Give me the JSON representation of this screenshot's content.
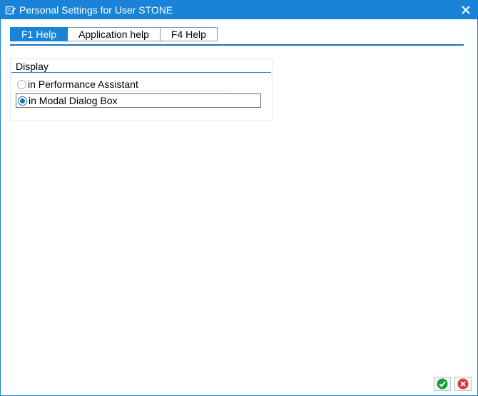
{
  "window": {
    "title": "Personal Settings for User STONE"
  },
  "tabs": [
    {
      "label": "F1 Help",
      "active": true
    },
    {
      "label": "Application help",
      "active": false
    },
    {
      "label": "F4 Help",
      "active": false
    }
  ],
  "display_group": {
    "title": "Display",
    "options": [
      {
        "label": "in Performance Assistant",
        "selected": false
      },
      {
        "label": "in Modal Dialog Box",
        "selected": true
      }
    ]
  },
  "icons": {
    "title": "settings-edit-icon",
    "close": "close-icon",
    "ok": "checkmark-icon",
    "cancel": "cancel-icon"
  },
  "colors": {
    "accent": "#1883d7",
    "ok_green": "#1e9b3c",
    "cancel_red": "#d9363e"
  }
}
